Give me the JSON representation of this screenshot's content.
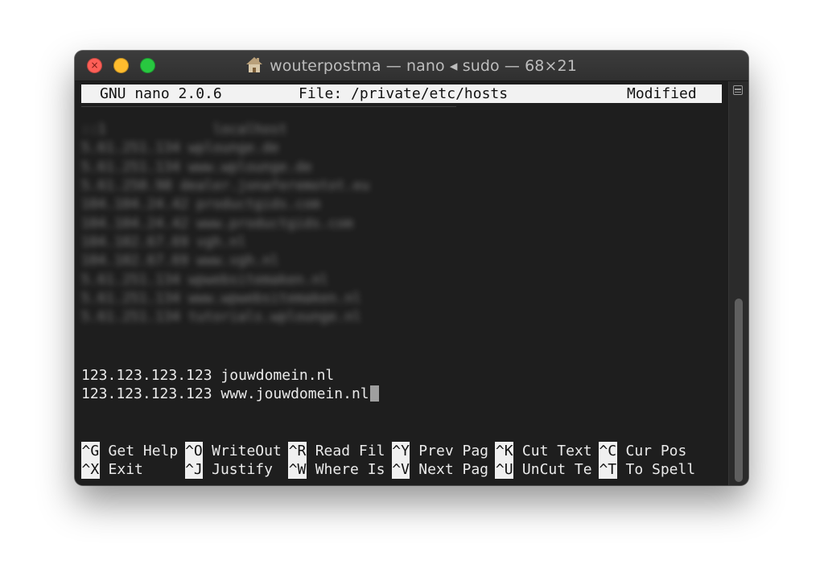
{
  "window": {
    "title": "wouterpostma — nano ◂ sudo — 68×21",
    "close_glyph": "×"
  },
  "nano": {
    "version": "GNU nano 2.0.6",
    "file": "File: /private/etc/hosts",
    "status": "Modified"
  },
  "blurred_lines": [
    "::1             localhost",
    "5.61.251.134 wplounge.de",
    "5.61.251.134 www.wplounge.de",
    "5.61.250.98 dealer.jonaferemotot.eu",
    "104.104.24.42 productgids.com",
    "104.104.24.42 www.productgids.com",
    "104.102.67.69 vgh.nl",
    "104.102.67.69 www.vgh.nl",
    "5.61.251.134 wpwebsitemaken.nl",
    "5.61.251.134 www.wpwebsitemaken.nl",
    "5.61.251.134 tutorials.wplounge.nl"
  ],
  "hosts_entries": [
    "123.123.123.123 jouwdomein.nl",
    "123.123.123.123 www.jouwdomein.nl"
  ],
  "shortcuts_row1": [
    {
      "key": "^G",
      "label": " Get Help"
    },
    {
      "key": "^O",
      "label": " WriteOut"
    },
    {
      "key": "^R",
      "label": " Read Fil"
    },
    {
      "key": "^Y",
      "label": " Prev Pag"
    },
    {
      "key": "^K",
      "label": " Cut Text"
    },
    {
      "key": "^C",
      "label": " Cur Pos"
    }
  ],
  "shortcuts_row2": [
    {
      "key": "^X",
      "label": " Exit"
    },
    {
      "key": "^J",
      "label": " Justify"
    },
    {
      "key": "^W",
      "label": " Where Is"
    },
    {
      "key": "^V",
      "label": " Next Pag"
    },
    {
      "key": "^U",
      "label": " UnCut Te"
    },
    {
      "key": "^T",
      "label": " To Spell"
    }
  ]
}
